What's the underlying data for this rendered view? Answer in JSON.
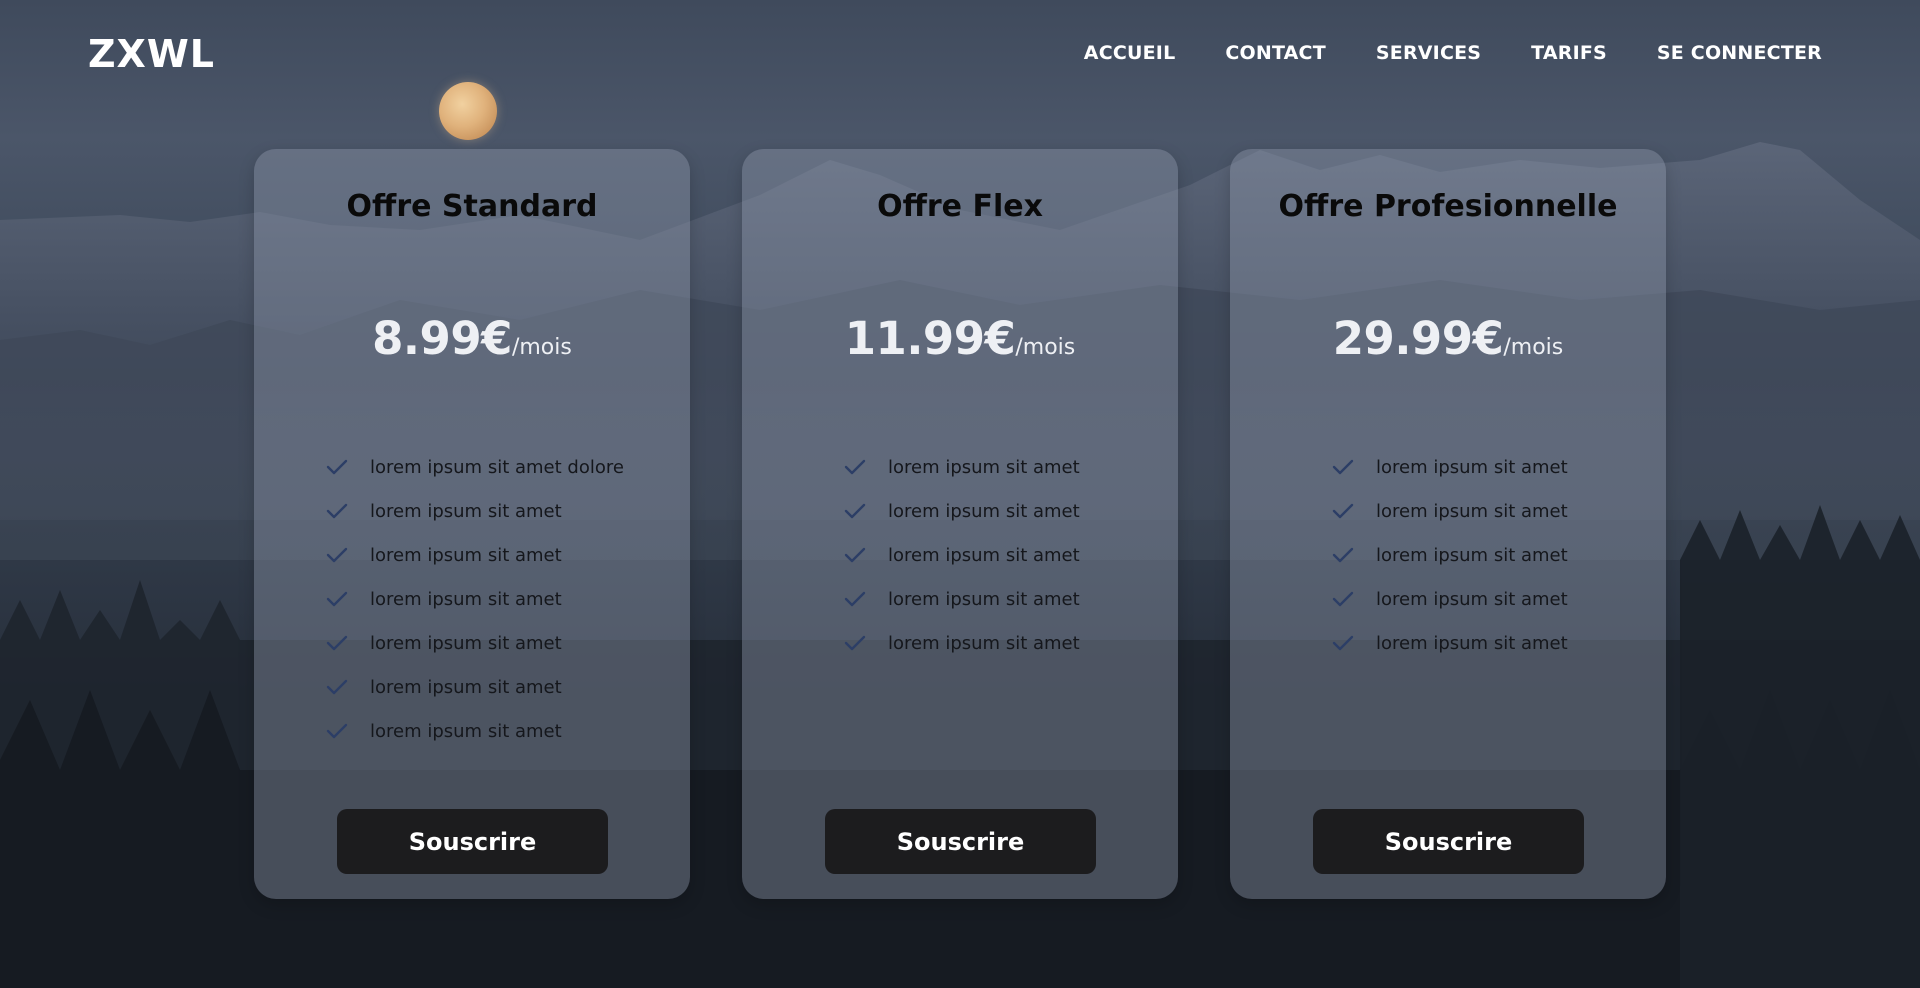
{
  "brand": {
    "logo": "ZXWL"
  },
  "nav": {
    "items": [
      {
        "label": "ACCUEIL"
      },
      {
        "label": "CONTACT"
      },
      {
        "label": "SERVICES"
      },
      {
        "label": "TARIFS"
      },
      {
        "label": "SE CONNECTER"
      }
    ]
  },
  "plans": [
    {
      "title": "Offre Standard",
      "price": "8.99€",
      "period": "/mois",
      "features": [
        "lorem ipsum sit amet dolore",
        "lorem ipsum sit amet",
        "lorem ipsum sit amet",
        "lorem ipsum sit amet",
        "lorem ipsum sit amet",
        "lorem ipsum sit amet",
        "lorem ipsum sit amet"
      ],
      "button_label": "Souscrire"
    },
    {
      "title": "Offre Flex",
      "price": "11.99€",
      "period": "/mois",
      "features": [
        "lorem ipsum sit amet",
        "lorem ipsum sit amet",
        "lorem ipsum sit amet",
        "lorem ipsum sit amet",
        "lorem ipsum sit amet"
      ],
      "button_label": "Souscrire"
    },
    {
      "title": "Offre Profesionnelle",
      "price": "29.99€",
      "period": "/mois",
      "features": [
        "lorem ipsum sit amet",
        "lorem ipsum sit amet",
        "lorem ipsum sit amet",
        "lorem ipsum sit amet",
        "lorem ipsum sit amet"
      ],
      "button_label": "Souscrire"
    }
  ],
  "icons": {
    "feature_check": "check-icon",
    "decoration": "moon-icon"
  },
  "colors": {
    "card_background": "#8c96aa",
    "button_background": "#1c1c1e",
    "check": "#2c3e66",
    "text_dark": "#0a0a0a",
    "price_text": "#eef0f4"
  }
}
